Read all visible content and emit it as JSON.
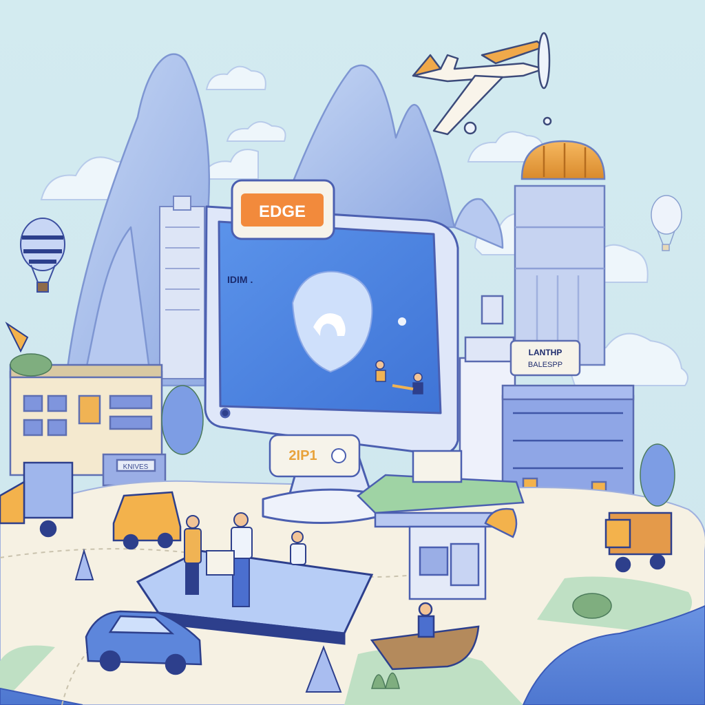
{
  "scene": {
    "monitor_badge": "EDGE",
    "screen_text": "IDIM .",
    "monitor_stand_label": "2IP1",
    "building_sign": {
      "line1": "LANTHP",
      "line2": "BALESPP"
    },
    "shop_sign": "KNIVES"
  },
  "colors": {
    "sky": "#cfe8ee",
    "mountain": "#a9c0ec",
    "screen": "#4f86e0",
    "badge": "#f28a3c",
    "water": "#5a84d8",
    "ground": "#f6f1e3",
    "grass": "#bfe0c4"
  }
}
